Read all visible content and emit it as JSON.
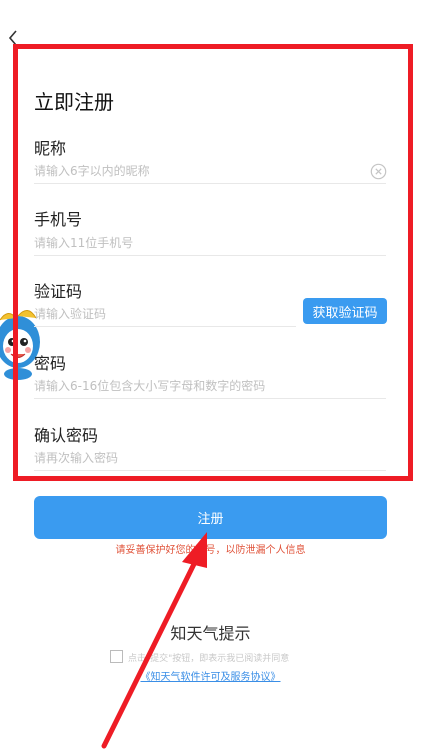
{
  "header": {
    "back_icon": "chevron-left-icon"
  },
  "form": {
    "title": "立即注册",
    "nickname": {
      "label": "昵称",
      "placeholder": "请输入6字以内的昵称",
      "clear_icon": "clear-circle-icon"
    },
    "phone": {
      "label": "手机号",
      "placeholder": "请输入11位手机号"
    },
    "code": {
      "label": "验证码",
      "placeholder": "请输入验证码",
      "button_label": "获取验证码"
    },
    "password": {
      "label": "密码",
      "placeholder": "请输入6-16位包含大小写字母和数字的密码"
    },
    "confirm": {
      "label": "确认密码",
      "placeholder": "请再次输入密码"
    }
  },
  "submit": {
    "label": "注册",
    "privacy_note": "请妥善保护好您的账号，以防泄漏个人信息"
  },
  "tips": {
    "title": "知天气提示",
    "agree_text": "点击\"提交\"按钮，即表示我已阅读并同意",
    "agreement_link": "《知天气软件许可及服务协议》"
  },
  "colors": {
    "accent": "#3a9bf0",
    "highlight_frame": "#ee1c25",
    "annotation_arrow": "#ee1c25",
    "warning_text": "#e0533a"
  }
}
